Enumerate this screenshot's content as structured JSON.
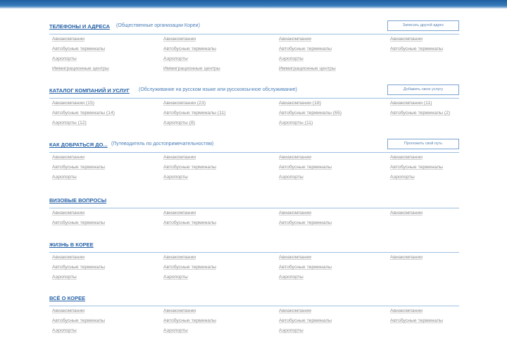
{
  "sections": [
    {
      "id": "phones",
      "title": "ТЕЛЕФОНЫ И АДРЕСА",
      "subtitle": "(Общественные организации Кореи)",
      "button": "Записать другой адрес",
      "rows": [
        [
          "Авиакомпании",
          "Авиакомпании",
          "Авиакомпании",
          "Авиакомпании"
        ],
        [
          "Автобусные терминалы",
          "Автобусные терминалы",
          "Автобусные терминалы",
          "Автобусные терминалы"
        ],
        [
          "Аэропорты",
          "Аэропорты",
          "Аэропорты",
          ""
        ],
        [
          "Иммиграционные центры",
          "Иммиграционные центры",
          "Иммиграционные центры",
          ""
        ]
      ]
    },
    {
      "id": "catalog",
      "title": "КАТАЛОГ КОМПАНИЙ И УСЛУГ",
      "subtitle": "(Обслуживание на русском языке или русскоязычное обслуживание)",
      "button": "Добавить свою услугу",
      "rows": [
        [
          "Авиакомпании (15)",
          "Авиакомпании (23)",
          "Авиакомпании (18)",
          "Авиакомпании (11)"
        ],
        [
          "Автобусные терминалы (14)",
          "Автобусные терминалы (11)",
          "Автобусные терминалы (65)",
          "Автобусные терминалы (2)"
        ],
        [
          "Аэропорты (12)",
          "Аэропорты (8)",
          "Аэропорты (11)",
          ""
        ]
      ]
    },
    {
      "id": "howto",
      "title": "КАК ДОБРАТЬСЯ ДО...",
      "subtitle": "(Путеводитель по достопримечательностям)",
      "button": "Проложить свой путь",
      "rows": [
        [
          "Авиакомпании",
          "Авиакомпании",
          "Авиакомпании",
          "Авиакомпании"
        ],
        [
          "Автобусные терминалы",
          "Автобусные терминалы",
          "Автобусные терминалы",
          "Автобусные терминалы"
        ],
        [
          "Аэропорты",
          "Аэропорты",
          "Аэропорты",
          "Аэропорты"
        ]
      ]
    },
    {
      "id": "visa",
      "title": "ВИЗОВЫЕ ВОПРОСЫ",
      "subtitle": "",
      "button": "",
      "rows": [
        [
          "Авиакомпании",
          "Авиакомпании",
          "Авиакомпании",
          "Авиакомпании"
        ],
        [
          "Автобусные терминалы",
          "Автобусные терминалы",
          "Автобусные терминалы",
          ""
        ]
      ]
    },
    {
      "id": "life",
      "title": "ЖИЗНЬ В КОРЕЕ",
      "subtitle": "",
      "button": "",
      "rows": [
        [
          "Авиакомпании",
          "Авиакомпании",
          "Авиакомпании",
          "Авиакомпании"
        ],
        [
          "Автобусные терминалы",
          "Автобусные терминалы",
          "Автобусные терминалы",
          ""
        ],
        [
          "Аэропорты",
          "Аэропорты",
          "Аэропорты",
          ""
        ]
      ]
    },
    {
      "id": "all",
      "title": "ВСЁ О КОРЕЕ",
      "subtitle": "",
      "button": "",
      "rows": [
        [
          "Авиакомпании",
          "Авиакомпании",
          "Авиакомпании",
          "Авиакомпании"
        ],
        [
          "Автобусные терминалы",
          "Автобусные терминалы",
          "Автобусные терминалы",
          "Автобусные терминалы"
        ],
        [
          "Аэропорты",
          "Аэропорты",
          "Аэропорты",
          ""
        ]
      ]
    }
  ]
}
